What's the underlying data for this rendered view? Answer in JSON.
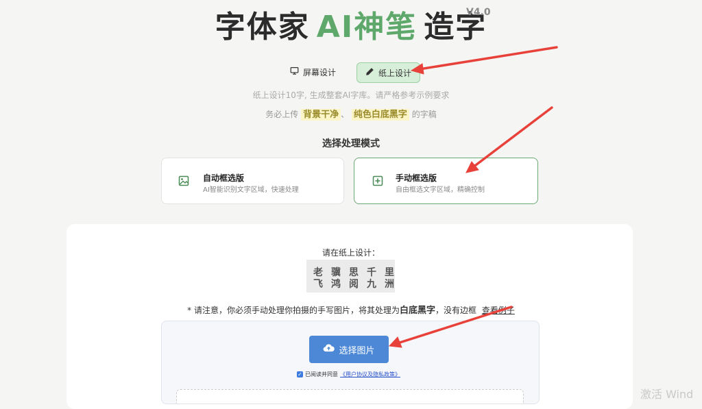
{
  "header": {
    "title_part1": "字体家",
    "title_ai": "AI神笔",
    "title_part2": "造字",
    "version": "V4.0"
  },
  "tabs": [
    {
      "label": "屏幕设计",
      "icon": "monitor-icon",
      "active": false
    },
    {
      "label": "纸上设计",
      "icon": "pencil-icon",
      "active": true
    }
  ],
  "subtitle": {
    "line1": "纸上设计10字, 生成整套AI字库。请严格参考示例要求",
    "line2_prefix": "务必上传",
    "highlight1": "背景干净",
    "sep": "、",
    "highlight2": "纯色白底黑字",
    "line2_suffix": "的字稿"
  },
  "mode_section": {
    "title": "选择处理模式",
    "options": [
      {
        "name": "自动框选版",
        "desc": "AI智能识别文字区域，快速处理",
        "icon": "image-icon",
        "selected": false
      },
      {
        "name": "手动框选版",
        "desc": "自由框选文字区域，精确控制",
        "icon": "plus-square-icon",
        "selected": true
      }
    ]
  },
  "design_panel": {
    "prompt": "请在纸上设计：",
    "chars_row1": [
      "老",
      "骥",
      "思",
      "千",
      "里"
    ],
    "chars_row2": [
      "飞",
      "鸿",
      "阅",
      "九",
      "洲"
    ],
    "notice_prefix": "* 请注意，你必须手动处理你拍摄的手写图片，将其处理为",
    "notice_bold": "白底黑字",
    "notice_suffix": "，没有边框",
    "example_link": "查看例子"
  },
  "upload": {
    "button_label": "选择图片",
    "agree_text": "已阅读并同意",
    "agree_link": "《用户协议及隐私政策》",
    "checked": true
  },
  "watermark": "激活 Wind",
  "colors": {
    "accent_green": "#5fa86c",
    "upload_blue": "#4c88d6",
    "arrow_red": "#e8413a"
  }
}
